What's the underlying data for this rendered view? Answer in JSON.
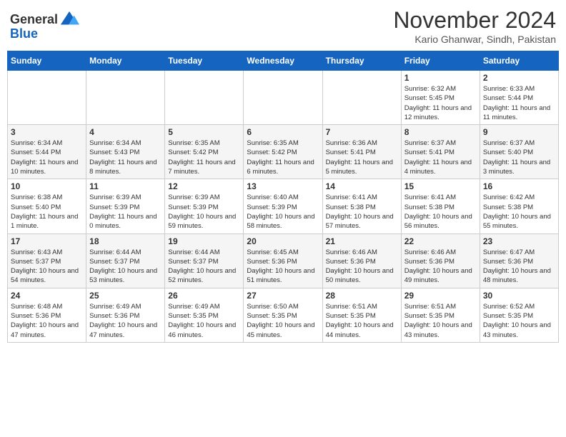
{
  "logo": {
    "general": "General",
    "blue": "Blue"
  },
  "header": {
    "month": "November 2024",
    "location": "Kario Ghanwar, Sindh, Pakistan"
  },
  "days_of_week": [
    "Sunday",
    "Monday",
    "Tuesday",
    "Wednesday",
    "Thursday",
    "Friday",
    "Saturday"
  ],
  "weeks": [
    [
      {
        "day": "",
        "info": ""
      },
      {
        "day": "",
        "info": ""
      },
      {
        "day": "",
        "info": ""
      },
      {
        "day": "",
        "info": ""
      },
      {
        "day": "",
        "info": ""
      },
      {
        "day": "1",
        "info": "Sunrise: 6:32 AM\nSunset: 5:45 PM\nDaylight: 11 hours and 12 minutes."
      },
      {
        "day": "2",
        "info": "Sunrise: 6:33 AM\nSunset: 5:44 PM\nDaylight: 11 hours and 11 minutes."
      }
    ],
    [
      {
        "day": "3",
        "info": "Sunrise: 6:34 AM\nSunset: 5:44 PM\nDaylight: 11 hours and 10 minutes."
      },
      {
        "day": "4",
        "info": "Sunrise: 6:34 AM\nSunset: 5:43 PM\nDaylight: 11 hours and 8 minutes."
      },
      {
        "day": "5",
        "info": "Sunrise: 6:35 AM\nSunset: 5:42 PM\nDaylight: 11 hours and 7 minutes."
      },
      {
        "day": "6",
        "info": "Sunrise: 6:35 AM\nSunset: 5:42 PM\nDaylight: 11 hours and 6 minutes."
      },
      {
        "day": "7",
        "info": "Sunrise: 6:36 AM\nSunset: 5:41 PM\nDaylight: 11 hours and 5 minutes."
      },
      {
        "day": "8",
        "info": "Sunrise: 6:37 AM\nSunset: 5:41 PM\nDaylight: 11 hours and 4 minutes."
      },
      {
        "day": "9",
        "info": "Sunrise: 6:37 AM\nSunset: 5:40 PM\nDaylight: 11 hours and 3 minutes."
      }
    ],
    [
      {
        "day": "10",
        "info": "Sunrise: 6:38 AM\nSunset: 5:40 PM\nDaylight: 11 hours and 1 minute."
      },
      {
        "day": "11",
        "info": "Sunrise: 6:39 AM\nSunset: 5:39 PM\nDaylight: 11 hours and 0 minutes."
      },
      {
        "day": "12",
        "info": "Sunrise: 6:39 AM\nSunset: 5:39 PM\nDaylight: 10 hours and 59 minutes."
      },
      {
        "day": "13",
        "info": "Sunrise: 6:40 AM\nSunset: 5:39 PM\nDaylight: 10 hours and 58 minutes."
      },
      {
        "day": "14",
        "info": "Sunrise: 6:41 AM\nSunset: 5:38 PM\nDaylight: 10 hours and 57 minutes."
      },
      {
        "day": "15",
        "info": "Sunrise: 6:41 AM\nSunset: 5:38 PM\nDaylight: 10 hours and 56 minutes."
      },
      {
        "day": "16",
        "info": "Sunrise: 6:42 AM\nSunset: 5:38 PM\nDaylight: 10 hours and 55 minutes."
      }
    ],
    [
      {
        "day": "17",
        "info": "Sunrise: 6:43 AM\nSunset: 5:37 PM\nDaylight: 10 hours and 54 minutes."
      },
      {
        "day": "18",
        "info": "Sunrise: 6:44 AM\nSunset: 5:37 PM\nDaylight: 10 hours and 53 minutes."
      },
      {
        "day": "19",
        "info": "Sunrise: 6:44 AM\nSunset: 5:37 PM\nDaylight: 10 hours and 52 minutes."
      },
      {
        "day": "20",
        "info": "Sunrise: 6:45 AM\nSunset: 5:36 PM\nDaylight: 10 hours and 51 minutes."
      },
      {
        "day": "21",
        "info": "Sunrise: 6:46 AM\nSunset: 5:36 PM\nDaylight: 10 hours and 50 minutes."
      },
      {
        "day": "22",
        "info": "Sunrise: 6:46 AM\nSunset: 5:36 PM\nDaylight: 10 hours and 49 minutes."
      },
      {
        "day": "23",
        "info": "Sunrise: 6:47 AM\nSunset: 5:36 PM\nDaylight: 10 hours and 48 minutes."
      }
    ],
    [
      {
        "day": "24",
        "info": "Sunrise: 6:48 AM\nSunset: 5:36 PM\nDaylight: 10 hours and 47 minutes."
      },
      {
        "day": "25",
        "info": "Sunrise: 6:49 AM\nSunset: 5:36 PM\nDaylight: 10 hours and 47 minutes."
      },
      {
        "day": "26",
        "info": "Sunrise: 6:49 AM\nSunset: 5:35 PM\nDaylight: 10 hours and 46 minutes."
      },
      {
        "day": "27",
        "info": "Sunrise: 6:50 AM\nSunset: 5:35 PM\nDaylight: 10 hours and 45 minutes."
      },
      {
        "day": "28",
        "info": "Sunrise: 6:51 AM\nSunset: 5:35 PM\nDaylight: 10 hours and 44 minutes."
      },
      {
        "day": "29",
        "info": "Sunrise: 6:51 AM\nSunset: 5:35 PM\nDaylight: 10 hours and 43 minutes."
      },
      {
        "day": "30",
        "info": "Sunrise: 6:52 AM\nSunset: 5:35 PM\nDaylight: 10 hours and 43 minutes."
      }
    ]
  ]
}
